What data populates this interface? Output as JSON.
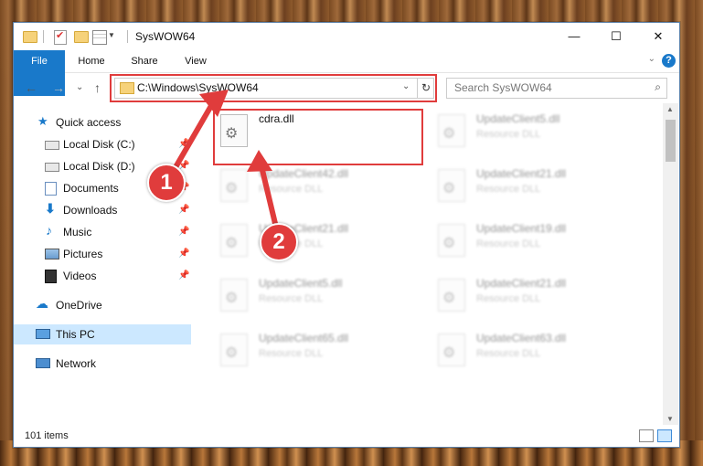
{
  "window": {
    "title": "SysWOW64",
    "controls": {
      "minimize": "—",
      "maximize": "☐",
      "close": "✕"
    }
  },
  "ribbon": {
    "tabs": [
      "File",
      "Home",
      "Share",
      "View"
    ],
    "help": "?",
    "expand": "⌄"
  },
  "address": {
    "path": "C:\\Windows\\SysWOW64",
    "dropdown": "⌄",
    "refresh": "↻"
  },
  "nav": {
    "back": "←",
    "forward": "→",
    "recent": "⌄",
    "up": "↑"
  },
  "search": {
    "placeholder": "Search SysWOW64",
    "icon": "search-icon"
  },
  "sidebar": {
    "items": [
      {
        "label": "Quick access",
        "icon": "star-icon",
        "pinned": false
      },
      {
        "label": "Local Disk (C:)",
        "icon": "drive-icon",
        "pinned": true
      },
      {
        "label": "Local Disk (D:)",
        "icon": "drive-icon",
        "pinned": true
      },
      {
        "label": "Documents",
        "icon": "documents-icon",
        "pinned": true
      },
      {
        "label": "Downloads",
        "icon": "download-icon",
        "pinned": true
      },
      {
        "label": "Music",
        "icon": "music-icon",
        "pinned": true
      },
      {
        "label": "Pictures",
        "icon": "pictures-icon",
        "pinned": true
      },
      {
        "label": "Videos",
        "icon": "videos-icon",
        "pinned": true
      },
      {
        "label": "OneDrive",
        "icon": "cloud-icon",
        "pinned": false
      },
      {
        "label": "This PC",
        "icon": "computer-icon",
        "pinned": false,
        "selected": true
      },
      {
        "label": "Network",
        "icon": "network-icon",
        "pinned": false
      }
    ]
  },
  "files": {
    "highlighted": {
      "name": "cdra.dll",
      "type": ""
    },
    "left": [
      {
        "name": "UpdateClient42.dll",
        "type": "Resource DLL"
      },
      {
        "name": "UpdateClient21.dll",
        "type": "Resource DLL"
      },
      {
        "name": "UpdateClient5.dll",
        "type": "Resource DLL"
      },
      {
        "name": "UpdateClient65.dll",
        "type": "Resource DLL"
      }
    ],
    "right": [
      {
        "name": "UpdateClient5.dll",
        "type": "Resource DLL"
      },
      {
        "name": "UpdateClient21.dll",
        "type": "Resource DLL"
      },
      {
        "name": "UpdateClient19.dll",
        "type": "Resource DLL"
      },
      {
        "name": "UpdateClient21.dll",
        "type": "Resource DLL"
      },
      {
        "name": "UpdateClient63.dll",
        "type": "Resource DLL"
      }
    ]
  },
  "status": {
    "count": "101 items"
  },
  "annotations": {
    "step1": "1",
    "step2": "2",
    "color": "#e03c3c"
  }
}
